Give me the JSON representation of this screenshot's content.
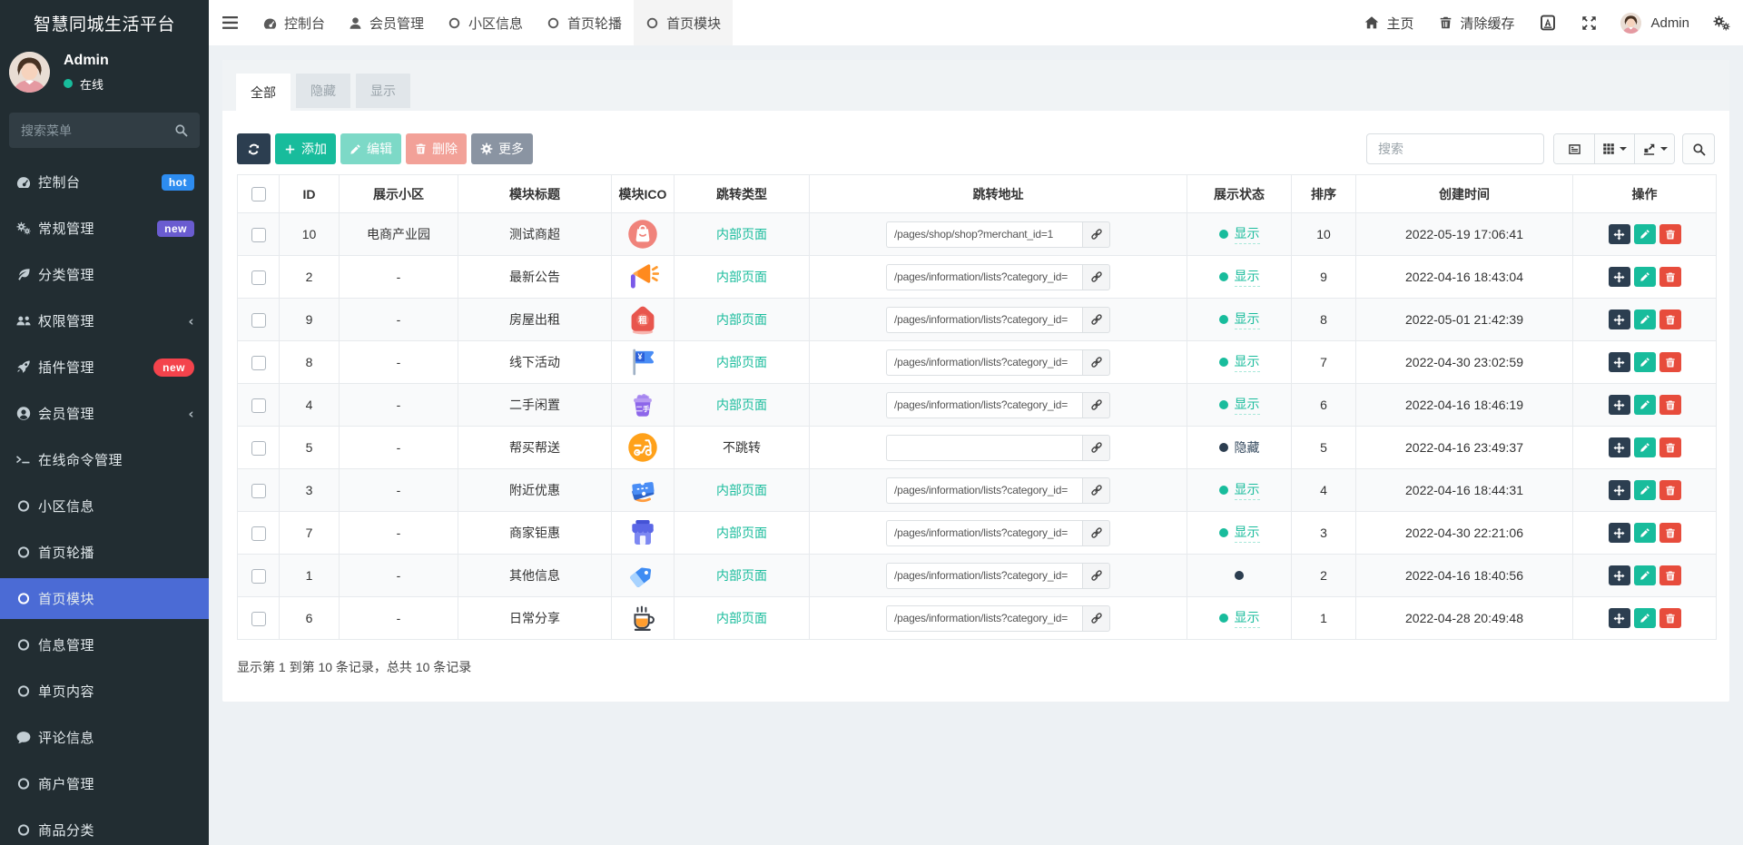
{
  "app": {
    "title": "智慧同城生活平台"
  },
  "user": {
    "name": "Admin",
    "status": "在线"
  },
  "sidebar": {
    "search_placeholder": "搜索菜单",
    "items": [
      {
        "label": "控制台",
        "icon": "dashboard",
        "badge": "hot",
        "badge_color": "#2d8cf0"
      },
      {
        "label": "常规管理",
        "icon": "cogs",
        "badge": "new",
        "badge_color": "#6a5cd0"
      },
      {
        "label": "分类管理",
        "icon": "leaf"
      },
      {
        "label": "权限管理",
        "icon": "users",
        "expandable": true
      },
      {
        "label": "插件管理",
        "icon": "rocket",
        "badge": "new",
        "badge_color": "#f4434c"
      },
      {
        "label": "会员管理",
        "icon": "user-circle",
        "expandable": true
      },
      {
        "label": "在线命令管理",
        "icon": "terminal"
      },
      {
        "label": "小区信息",
        "icon": "circle"
      },
      {
        "label": "首页轮播",
        "icon": "circle"
      },
      {
        "label": "首页模块",
        "icon": "circle",
        "active": true
      },
      {
        "label": "信息管理",
        "icon": "circle"
      },
      {
        "label": "单页内容",
        "icon": "circle"
      },
      {
        "label": "评论信息",
        "icon": "comment"
      },
      {
        "label": "商户管理",
        "icon": "circle"
      },
      {
        "label": "商品分类",
        "icon": "circle"
      }
    ]
  },
  "topnav": {
    "tabs": [
      {
        "label": "控制台",
        "icon": "dashboard"
      },
      {
        "label": "会员管理",
        "icon": "user"
      },
      {
        "label": "小区信息",
        "icon": "circle"
      },
      {
        "label": "首页轮播",
        "icon": "circle"
      },
      {
        "label": "首页模块",
        "icon": "circle",
        "active": true
      }
    ],
    "home": "主页",
    "clear_cache": "清除缓存",
    "username": "Admin"
  },
  "panel": {
    "tabs": [
      {
        "label": "全部",
        "active": true
      },
      {
        "label": "隐藏"
      },
      {
        "label": "显示"
      }
    ],
    "toolbar": {
      "add": "添加",
      "edit": "编辑",
      "delete": "删除",
      "more": "更多",
      "search_placeholder": "搜索"
    }
  },
  "table": {
    "columns": {
      "id": "ID",
      "community": "展示小区",
      "title": "模块标题",
      "ico": "模块ICO",
      "jump_type": "跳转类型",
      "jump_url": "跳转地址",
      "status": "展示状态",
      "sort": "排序",
      "created": "创建时间",
      "operate": "操作"
    },
    "jump_type_internal": "内部页面",
    "jump_type_none": "不跳转",
    "status_show": "显示",
    "status_hide": "隐藏",
    "rows": [
      {
        "id": "10",
        "community": "电商产业园",
        "title": "测试商超",
        "icon": "shop",
        "jump_type": "internal",
        "url": "/pages/shop/shop?merchant_id=1",
        "status": "show",
        "status_label": "显示",
        "sort": "10",
        "created": "2022-05-19 17:06:41"
      },
      {
        "id": "2",
        "community": "-",
        "title": "最新公告",
        "icon": "megaphone",
        "jump_type": "internal",
        "url": "/pages/information/lists?category_id=",
        "status": "show",
        "status_label": "显示",
        "sort": "9",
        "created": "2022-04-16 18:43:04"
      },
      {
        "id": "9",
        "community": "-",
        "title": "房屋出租",
        "icon": "house",
        "jump_type": "internal",
        "url": "/pages/information/lists?category_id=",
        "status": "show",
        "status_label": "显示",
        "sort": "8",
        "created": "2022-05-01 21:42:39"
      },
      {
        "id": "8",
        "community": "-",
        "title": "线下活动",
        "icon": "flag",
        "jump_type": "internal",
        "url": "/pages/information/lists?category_id=",
        "status": "show",
        "status_label": "显示",
        "sort": "7",
        "created": "2022-04-30 23:02:59"
      },
      {
        "id": "4",
        "community": "-",
        "title": "二手闲置",
        "icon": "basket",
        "jump_type": "internal",
        "url": "/pages/information/lists?category_id=",
        "status": "show",
        "status_label": "显示",
        "sort": "6",
        "created": "2022-04-16 18:46:19"
      },
      {
        "id": "5",
        "community": "-",
        "title": "帮买帮送",
        "icon": "scooter",
        "jump_type": "none",
        "url": "",
        "status": "hide",
        "status_label": "隐藏",
        "sort": "5",
        "created": "2022-04-16 23:49:37"
      },
      {
        "id": "3",
        "community": "-",
        "title": "附近优惠",
        "icon": "tickets",
        "jump_type": "internal",
        "url": "/pages/information/lists?category_id=",
        "status": "show",
        "status_label": "显示",
        "sort": "4",
        "created": "2022-04-16 18:44:31"
      },
      {
        "id": "7",
        "community": "-",
        "title": "商家钜惠",
        "icon": "store",
        "jump_type": "internal",
        "url": "/pages/information/lists?category_id=",
        "status": "show",
        "status_label": "显示",
        "sort": "3",
        "created": "2022-04-30 22:21:06"
      },
      {
        "id": "1",
        "community": "-",
        "title": "其他信息",
        "icon": "tag",
        "jump_type": "internal",
        "url": "/pages/information/lists?category_id=",
        "status": "hide",
        "status_label": "",
        "sort": "2",
        "created": "2022-04-16 18:40:56"
      },
      {
        "id": "6",
        "community": "-",
        "title": "日常分享",
        "icon": "coffee",
        "jump_type": "internal",
        "url": "/pages/information/lists?category_id=",
        "status": "show",
        "status_label": "显示",
        "sort": "1",
        "created": "2022-04-28 20:49:48"
      }
    ],
    "summary": "显示第 1 到第 10 条记录，总共 10 条记录"
  },
  "colors": {
    "sidebar_bg": "#222d32",
    "sidebar_active": "#4b6bd5",
    "primary": "#2c3e50",
    "success": "#18bc9c",
    "danger": "#e74c3c",
    "more_gray": "#8a94a2",
    "badge_hot": "#2d8cf0",
    "badge_new_purple": "#6a5cd0",
    "badge_new_red": "#f4434c",
    "content_bg": "#edf1f4"
  }
}
